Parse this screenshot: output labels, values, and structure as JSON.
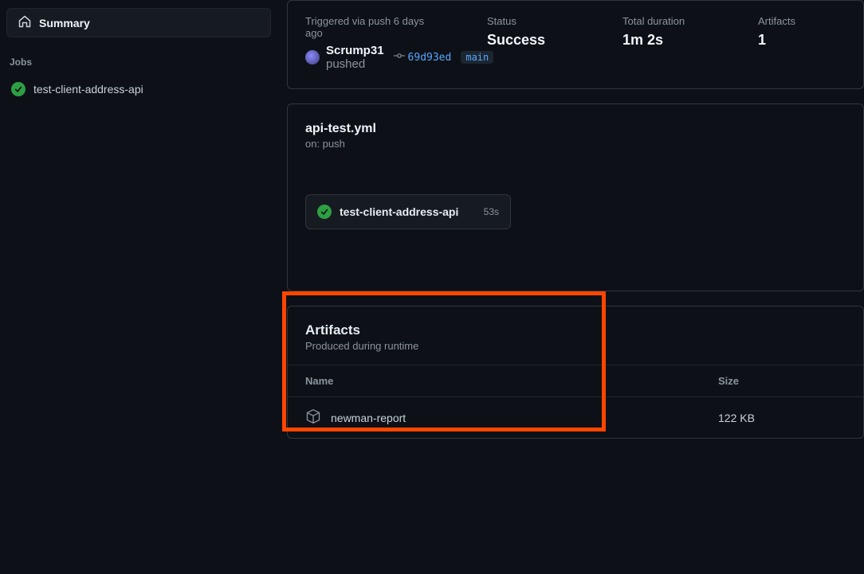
{
  "sidebar": {
    "summary_label": "Summary",
    "jobs_heading": "Jobs",
    "jobs": [
      {
        "name": "test-client-address-api",
        "status": "success"
      }
    ]
  },
  "summary": {
    "trigger_label": "Triggered via push 6 days ago",
    "author": "Scrump31",
    "pushed_word": "pushed",
    "commit_sha": "69d93ed",
    "branch": "main",
    "status_label": "Status",
    "status_value": "Success",
    "duration_label": "Total duration",
    "duration_value": "1m 2s",
    "artifacts_label": "Artifacts",
    "artifacts_count": "1"
  },
  "workflow": {
    "filename": "api-test.yml",
    "trigger_line": "on: push",
    "job": {
      "name": "test-client-address-api",
      "duration": "53s",
      "status": "success"
    }
  },
  "artifacts": {
    "title": "Artifacts",
    "subtitle": "Produced during runtime",
    "col_name": "Name",
    "col_size": "Size",
    "rows": [
      {
        "name": "newman-report",
        "size": "122 KB"
      }
    ]
  }
}
